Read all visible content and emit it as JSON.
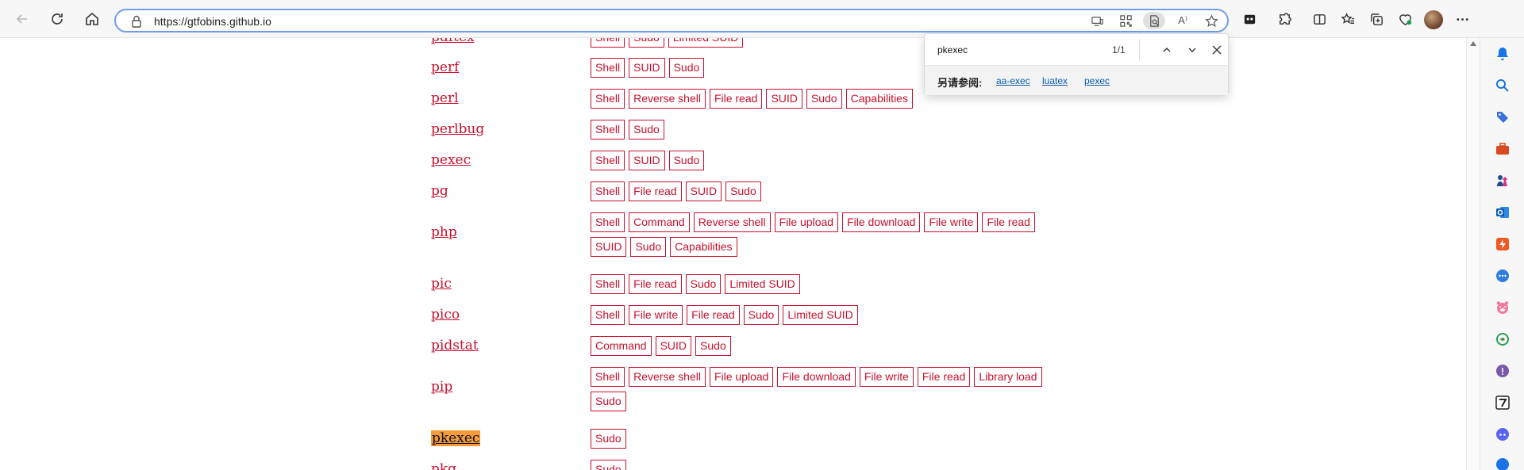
{
  "browser": {
    "url": "https://gtfobins.github.io",
    "nav": {
      "back": "back-icon",
      "refresh": "refresh-icon",
      "home": "home-icon"
    },
    "address_icons": [
      "device-icon",
      "qr-code-icon",
      "find-on-page-icon",
      "read-aloud-icon",
      "favorite-star-icon"
    ],
    "read_aloud_label": "A⁾"
  },
  "find_bar": {
    "query": "pkexec",
    "count": "1/1",
    "see_also_label": "另请参阅:",
    "see_also": [
      "aa-exec",
      "luatex",
      "pexec"
    ]
  },
  "rows": [
    {
      "name": "pdftex",
      "tags": [
        "Shell",
        "Sudo",
        "Limited SUID"
      ]
    },
    {
      "name": "perf",
      "tags": [
        "Shell",
        "SUID",
        "Sudo"
      ]
    },
    {
      "name": "perl",
      "tags": [
        "Shell",
        "Reverse shell",
        "File read",
        "SUID",
        "Sudo",
        "Capabilities"
      ]
    },
    {
      "name": "perlbug",
      "tags": [
        "Shell",
        "Sudo"
      ]
    },
    {
      "name": "pexec",
      "tags": [
        "Shell",
        "SUID",
        "Sudo"
      ]
    },
    {
      "name": "pg",
      "tags": [
        "Shell",
        "File read",
        "SUID",
        "Sudo"
      ]
    },
    {
      "name": "php",
      "tags": [
        "Shell",
        "Command",
        "Reverse shell",
        "File upload",
        "File download",
        "File write",
        "File read",
        "SUID",
        "Sudo",
        "Capabilities"
      ]
    },
    {
      "name": "pic",
      "tags": [
        "Shell",
        "File read",
        "Sudo",
        "Limited SUID"
      ]
    },
    {
      "name": "pico",
      "tags": [
        "Shell",
        "File write",
        "File read",
        "Sudo",
        "Limited SUID"
      ]
    },
    {
      "name": "pidstat",
      "tags": [
        "Command",
        "SUID",
        "Sudo"
      ]
    },
    {
      "name": "pip",
      "tags": [
        "Shell",
        "Reverse shell",
        "File upload",
        "File download",
        "File write",
        "File read",
        "Library load",
        "Sudo"
      ]
    },
    {
      "name": "pkexec",
      "tags": [
        "Sudo"
      ],
      "highlight": true
    },
    {
      "name": "pkg",
      "tags": [
        "Sudo"
      ]
    }
  ],
  "colors": {
    "link": "#c8102e",
    "tag_border": "#c8102e",
    "highlight": "#f59b3a",
    "address_focus": "#6f9ee8"
  }
}
